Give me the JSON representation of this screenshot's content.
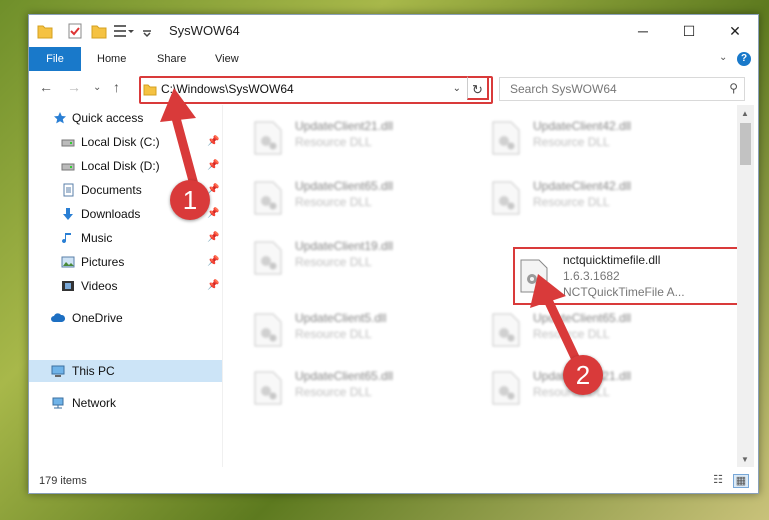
{
  "window": {
    "title": "SysWOW64",
    "controls": {
      "minimize": "─",
      "maximize": "☐",
      "close": "✕"
    }
  },
  "ribbon": {
    "tabs": [
      "File",
      "Home",
      "Share",
      "View"
    ],
    "help": "?"
  },
  "nav": {
    "address": "C:\\Windows\\SysWOW64",
    "search_placeholder": "Search SysWOW64"
  },
  "sidebar": {
    "items": [
      {
        "label": "Quick access",
        "icon": "star-icon",
        "pinned": false
      },
      {
        "label": "Local Disk (C:)",
        "icon": "drive-icon",
        "pinned": true
      },
      {
        "label": "Local Disk (D:)",
        "icon": "drive-icon",
        "pinned": true
      },
      {
        "label": "Documents",
        "icon": "documents-icon",
        "pinned": true
      },
      {
        "label": "Downloads",
        "icon": "download-icon",
        "pinned": true
      },
      {
        "label": "Music",
        "icon": "music-icon",
        "pinned": true
      },
      {
        "label": "Pictures",
        "icon": "pictures-icon",
        "pinned": true
      },
      {
        "label": "Videos",
        "icon": "videos-icon",
        "pinned": true
      },
      {
        "label": "OneDrive",
        "icon": "cloud-icon",
        "pinned": false
      },
      {
        "label": "This PC",
        "icon": "pc-icon",
        "pinned": false
      },
      {
        "label": "Network",
        "icon": "network-icon",
        "pinned": false
      }
    ]
  },
  "files": [
    {
      "name": "UpdateClient21.dll",
      "desc": "Resource DLL"
    },
    {
      "name": "UpdateClient42.dll",
      "desc": "Resource DLL"
    },
    {
      "name": "UpdateClient65.dll",
      "desc": "Resource DLL"
    },
    {
      "name": "UpdateClient42.dll",
      "desc": "Resource DLL"
    },
    {
      "name": "UpdateClient19.dll",
      "desc": "Resource DLL"
    },
    {
      "name": "nctquicktimefile.dll",
      "version": "1.6.3.1682",
      "desc": "NCTQuickTimeFile  A..."
    },
    {
      "name": "UpdateClient5.dll",
      "desc": "Resource DLL"
    },
    {
      "name": "UpdateClient65.dll",
      "desc": "Resource DLL"
    },
    {
      "name": "UpdateClient65.dll",
      "desc": "Resource DLL"
    },
    {
      "name": "UpdateClient21.dll",
      "desc": "Resource DLL"
    }
  ],
  "status": {
    "count": "179 items"
  },
  "callouts": {
    "one": "1",
    "two": "2"
  },
  "colors": {
    "accent": "#1979ca",
    "highlight": "#d93a3a"
  }
}
